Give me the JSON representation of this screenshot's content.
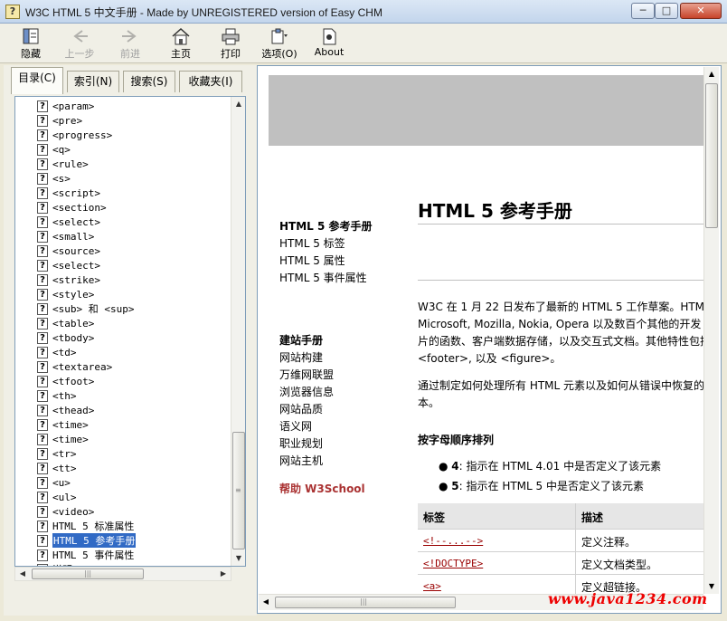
{
  "window": {
    "title": "W3C HTML 5 中文手册 - Made by UNREGISTERED version of Easy CHM",
    "min_label": "─",
    "max_label": "□",
    "close_label": "✕"
  },
  "toolbar": {
    "items": [
      {
        "label": "隐藏",
        "icon": "hide-icon"
      },
      {
        "label": "上一步",
        "icon": "back-arrow-icon"
      },
      {
        "label": "前进",
        "icon": "forward-arrow-icon"
      },
      {
        "label": "主页",
        "icon": "home-icon"
      },
      {
        "label": "打印",
        "icon": "print-icon"
      },
      {
        "label": "选项(O)",
        "icon": "options-icon"
      },
      {
        "label": "About",
        "icon": "about-icon"
      }
    ]
  },
  "left": {
    "tabs": [
      "目录(C)",
      "索引(N)",
      "搜索(S)",
      "收藏夹(I)"
    ],
    "tree": [
      "<param>",
      "<pre>",
      "<progress>",
      "<q>",
      "<rule>",
      "<s>",
      "<script>",
      "<section>",
      "<select>",
      "<small>",
      "<source>",
      "<select>",
      "<strike>",
      "<style>",
      "<sub> 和 <sup>",
      "<table>",
      "<tbody>",
      "<td>",
      "<textarea>",
      "<tfoot>",
      "<th>",
      "<thead>",
      "<time>",
      "<time>",
      "<tr>",
      "<tt>",
      "<u>",
      "<ul>",
      "<video>",
      "HTML 5 标准属性",
      "HTML 5 参考手册",
      "HTML 5 事件属性",
      "说明"
    ],
    "selected_index": 30
  },
  "content": {
    "nav_primary": [
      "HTML 5 参考手册",
      "HTML 5 标签",
      "HTML 5 属性",
      "HTML 5 事件属性"
    ],
    "nav_secondary_title": "建站手册",
    "nav_secondary": [
      "网站构建",
      "万维网联盟",
      "浏览器信息",
      "网站品质",
      "语义网",
      "职业规划",
      "网站主机"
    ],
    "help_link": "帮助 W3School",
    "heading": "HTML 5 参考手册",
    "para1": [
      "W3C 在 1 月 22 日发布了最新的 HTML 5 工作草案。HTM",
      "Microsoft, Mozilla, Nokia, Opera 以及数百个其他的开发",
      "片的函数、客户端数据存储，以及交互式文档。其他特性包括",
      "<footer>, 以及 <figure>。"
    ],
    "para2": [
      "通过制定如何处理所有 HTML 元素以及如何从错误中恢复的",
      "本。"
    ],
    "subheading": "按字母顺序排列",
    "bullets": [
      {
        "key": "4",
        "text": ": 指示在 HTML 4.01 中是否定义了该元素"
      },
      {
        "key": "5",
        "text": ": 指示在 HTML 5 中是否定义了该元素"
      }
    ],
    "table": {
      "headers": [
        "标签",
        "描述"
      ],
      "rows": [
        [
          "<!--...-->",
          "定义注释。"
        ],
        [
          "<!DOCTYPE>",
          "定义文档类型。"
        ],
        [
          "<a>",
          "定义超链接。"
        ]
      ]
    }
  },
  "watermark": "www.java1234.com"
}
